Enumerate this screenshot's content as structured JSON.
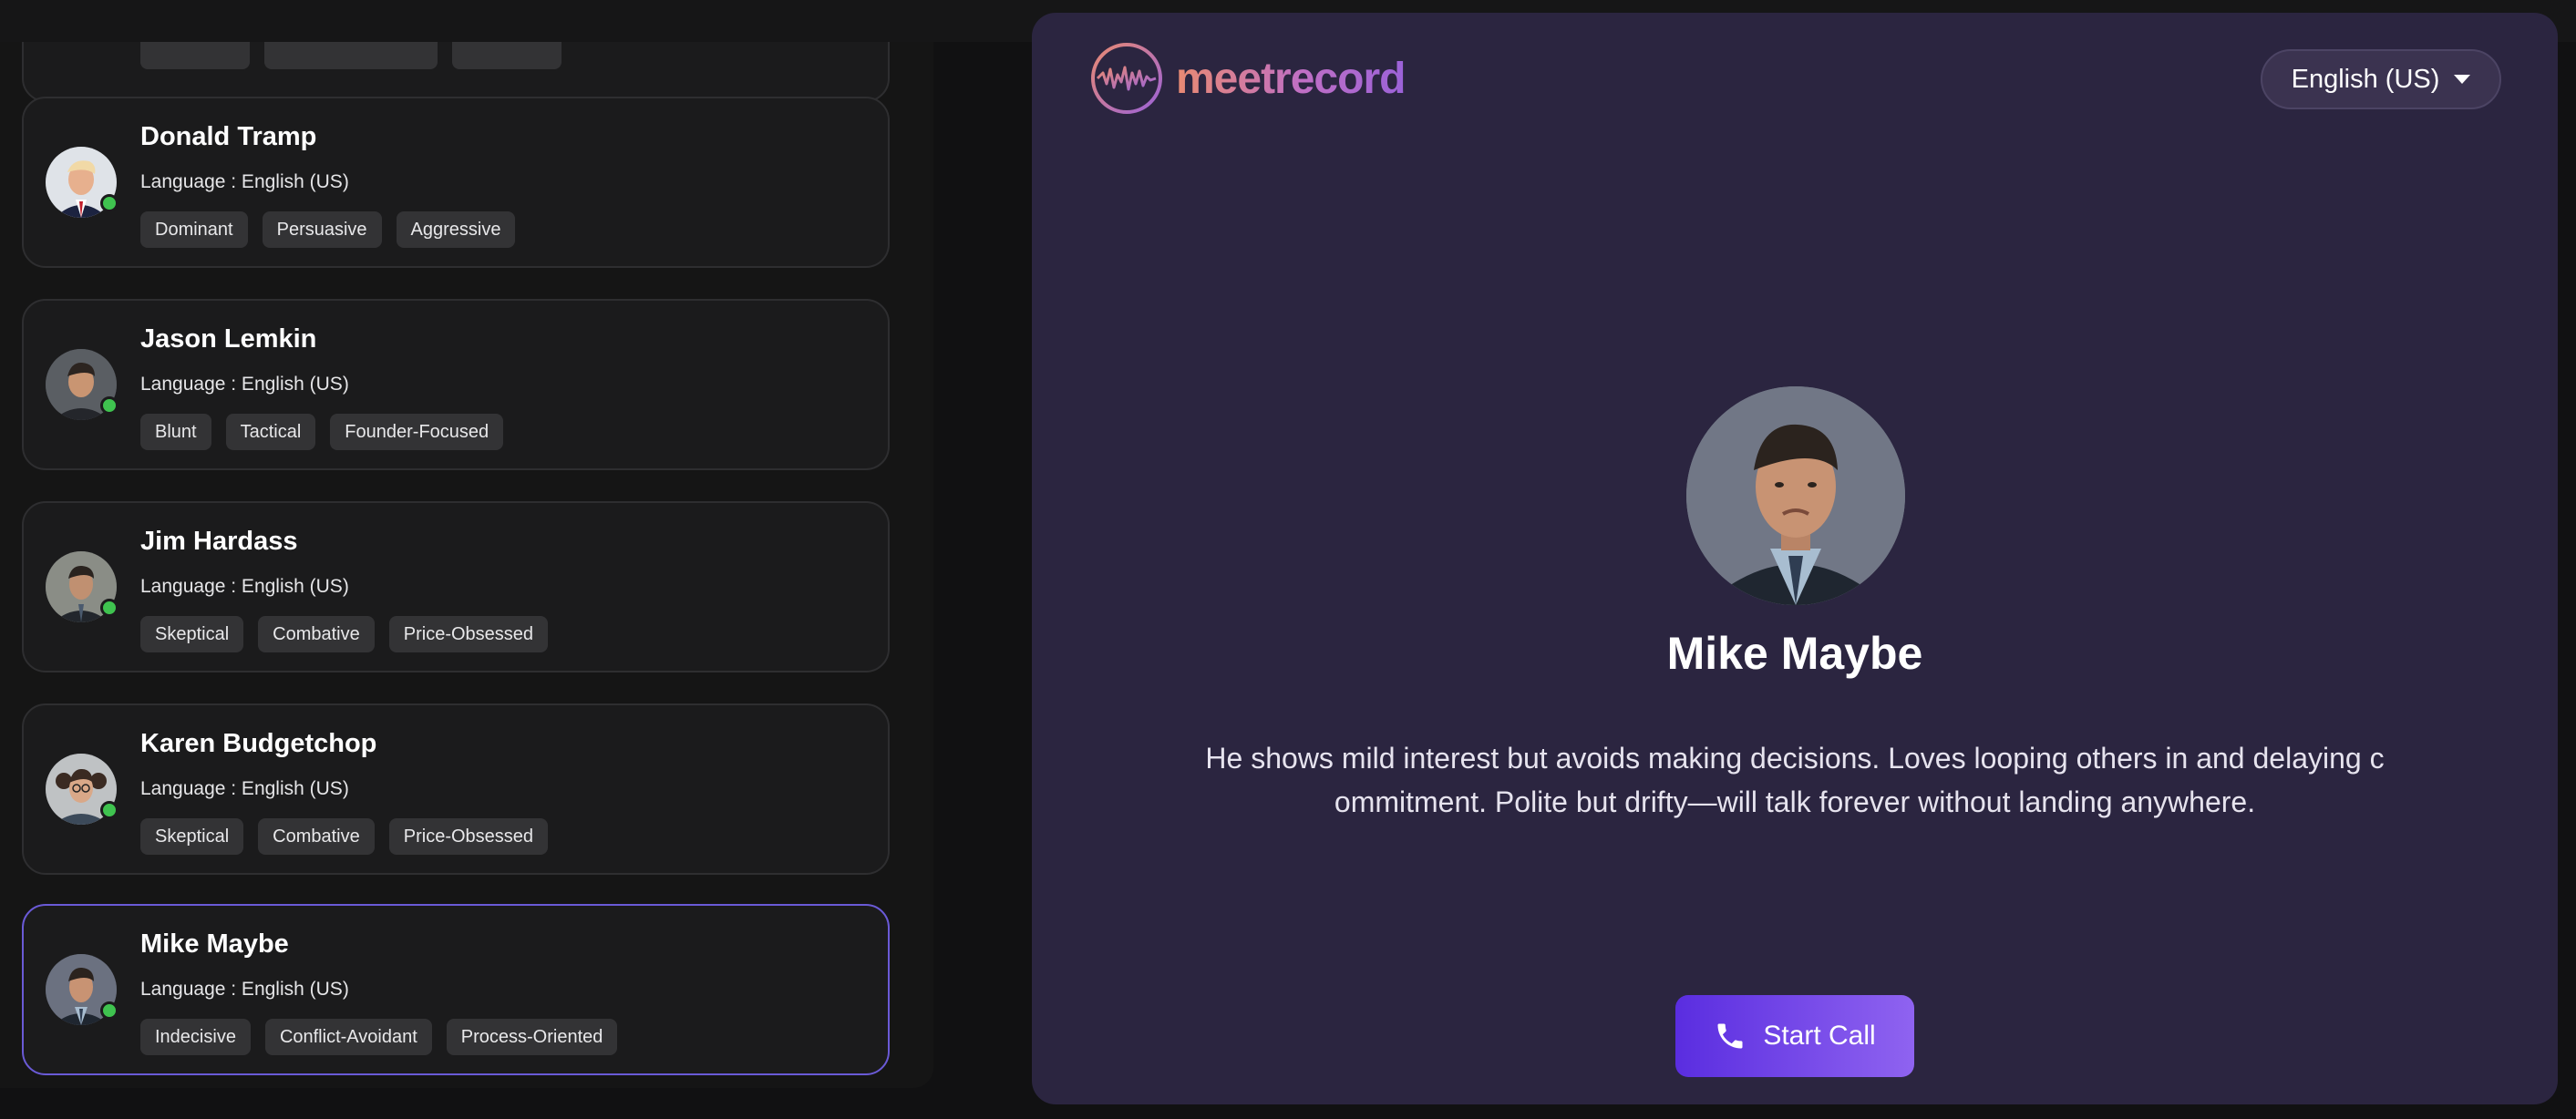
{
  "agents": [
    {
      "name": "",
      "language": "",
      "tags": [
        "",
        "",
        ""
      ],
      "partial": true
    },
    {
      "name": "Donald Tramp",
      "language": "Language : English (US)",
      "tags": [
        "Dominant",
        "Persuasive",
        "Aggressive"
      ],
      "avatar": "avatar-donald"
    },
    {
      "name": "Jason Lemkin",
      "language": "Language : English (US)",
      "tags": [
        "Blunt",
        "Tactical",
        "Founder-Focused"
      ],
      "avatar": "avatar-jason"
    },
    {
      "name": "Jim Hardass",
      "language": "Language : English (US)",
      "tags": [
        "Skeptical",
        "Combative",
        "Price-Obsessed"
      ],
      "avatar": "avatar-jim"
    },
    {
      "name": "Karen Budgetchop",
      "language": "Language : English (US)",
      "tags": [
        "Skeptical",
        "Combative",
        "Price-Obsessed"
      ],
      "avatar": "avatar-karen"
    },
    {
      "name": "Mike Maybe",
      "language": "Language : English (US)",
      "tags": [
        "Indecisive",
        "Conflict-Avoidant",
        "Process-Oriented"
      ],
      "avatar": "avatar-mike",
      "selected": true
    }
  ],
  "brand": {
    "name": "meetrecord",
    "icon": "soundwave-logo-icon"
  },
  "language_select": {
    "value": "English (US)",
    "icon": "caret-down-icon"
  },
  "selected": {
    "name": "Mike Maybe",
    "description": "He shows mild interest but avoids making decisions. Loves looping others in and delaying commitment. Polite but drifty—will talk forever without landing anywhere.",
    "photo": "mike-maybe-photo"
  },
  "start_call": {
    "label": "Start Call",
    "icon": "phone-icon"
  },
  "colors": {
    "accent": "#6a5ad6",
    "online": "#3fc34f",
    "right_panel_bg": "#2b2540",
    "button_gradient_start": "#5a2de0",
    "button_gradient_end": "#8f63f0"
  }
}
